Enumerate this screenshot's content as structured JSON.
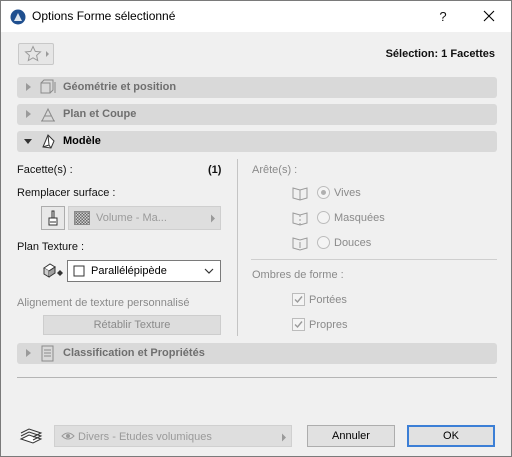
{
  "window": {
    "title": "Options Forme sélectionné",
    "help_label": "?"
  },
  "toolbar": {
    "selection_label": "Sélection: 1 Facettes"
  },
  "panels": {
    "geometry": {
      "label": "Géométrie et position",
      "state": "collapsed"
    },
    "plan": {
      "label": "Plan et Coupe",
      "state": "collapsed"
    },
    "model": {
      "label": "Modèle",
      "state": "expanded"
    },
    "classification": {
      "label": "Classification et Propriétés",
      "state": "collapsed"
    }
  },
  "model": {
    "facets_label": "Facette(s) :",
    "facets_count": "(1)",
    "replace_surface_label": "Remplacer surface :",
    "surface_value": "Volume - Ma...",
    "texture_plan_label": "Plan Texture :",
    "texture_plan_value": "Parallélépipède",
    "custom_alignment_label": "Alignement de texture personnalisé",
    "reset_texture_label": "Rétablir Texture",
    "edges_label": "Arête(s) :",
    "edges_options": {
      "vives": "Vives",
      "masquees": "Masquées",
      "douces": "Douces"
    },
    "edges_selected": "Vives",
    "shadows_label": "Ombres de forme :",
    "shadows_options": {
      "portees": "Portées",
      "propres": "Propres"
    },
    "shadows_checked": {
      "portees": true,
      "propres": true
    }
  },
  "footer": {
    "layer_value": "Divers - Etudes volumiques",
    "cancel_label": "Annuler",
    "ok_label": "OK"
  },
  "colors": {
    "accent": "#3c7fd6",
    "panel_header": "#d9d9d9",
    "background": "#f0f0f0"
  }
}
